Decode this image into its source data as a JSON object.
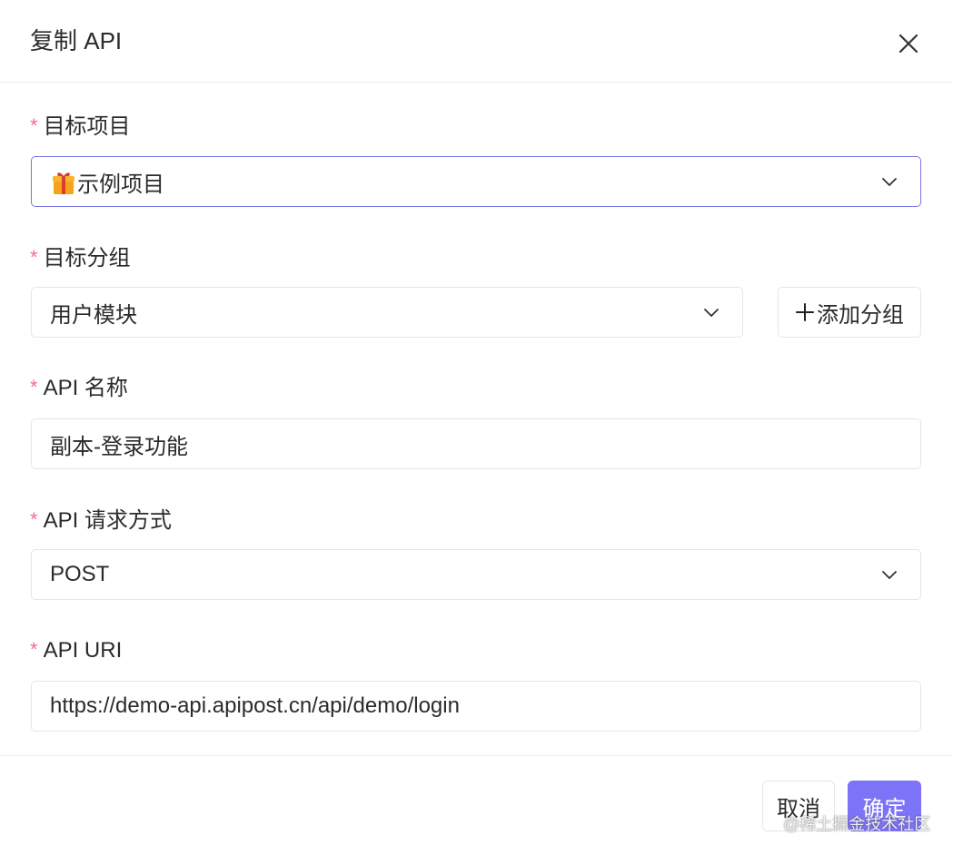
{
  "dialog": {
    "title": "复制 API",
    "close_icon": "close-icon"
  },
  "fields": {
    "project": {
      "required_mark": "*",
      "label": "目标项目",
      "icon": "gift-icon",
      "value": "示例项目"
    },
    "group": {
      "required_mark": "*",
      "label": "目标分组",
      "value": "用户模块",
      "add_icon": "plus-icon",
      "add_label": "添加分组"
    },
    "name": {
      "required_mark": "*",
      "label": "API 名称",
      "value": "副本-登录功能"
    },
    "method": {
      "required_mark": "*",
      "label": "API 请求方式",
      "value": "POST"
    },
    "uri": {
      "required_mark": "*",
      "label": "API URI",
      "value": "https://demo-api.apipost.cn/api/demo/login"
    }
  },
  "footer": {
    "cancel_label": "取消",
    "confirm_label": "确定"
  },
  "watermark": "@稀土掘金技术社区",
  "colors": {
    "accent": "#7c73f6",
    "focus_border": "#7b76e8",
    "required": "#f0718b"
  }
}
